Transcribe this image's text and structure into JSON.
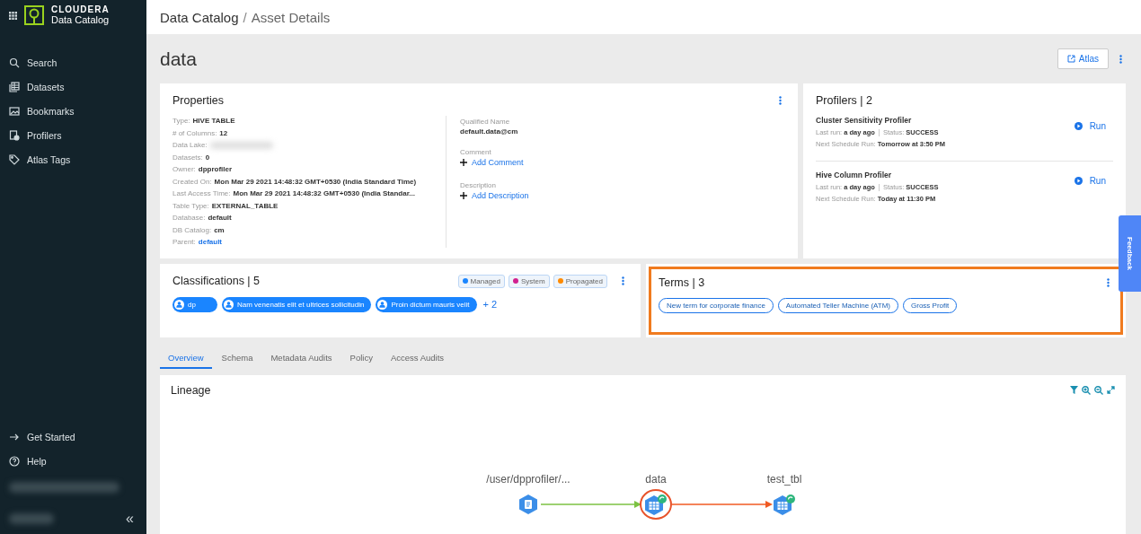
{
  "sidebar": {
    "brand": {
      "name": "CLOUDERA",
      "product": "Data Catalog"
    },
    "items": [
      {
        "label": "Search",
        "selected": false
      },
      {
        "label": "Datasets",
        "selected": false
      },
      {
        "label": "Bookmarks",
        "selected": false
      },
      {
        "label": "Profilers",
        "selected": false
      },
      {
        "label": "Atlas Tags",
        "selected": false
      }
    ],
    "footer_items": [
      {
        "label": "Get Started"
      },
      {
        "label": "Help"
      }
    ],
    "collapse": "«"
  },
  "header": {
    "breadcrumb": [
      "Data Catalog",
      "Asset Details"
    ],
    "separator": "/"
  },
  "asset": {
    "title": "data",
    "atlas_button": "Atlas"
  },
  "properties": {
    "title": "Properties",
    "fields": [
      {
        "label": "Type:",
        "value": "HIVE TABLE",
        "kind": "text"
      },
      {
        "label": "# of Columns:",
        "value": "12",
        "kind": "text"
      },
      {
        "label": "Data Lake:",
        "kind": "redacted"
      },
      {
        "label": "Datasets:",
        "value": "0",
        "kind": "text"
      },
      {
        "label": "Owner:",
        "value": "dpprofiler",
        "kind": "text"
      },
      {
        "label": "Created On:",
        "value": "Mon Mar 29 2021 14:48:32 GMT+0530 (India Standard Time)",
        "kind": "text"
      },
      {
        "label": "Last Access Time:",
        "value": "Mon Mar 29 2021 14:48:32 GMT+0530 (India Standar...",
        "kind": "text"
      },
      {
        "label": "Table Type:",
        "value": "EXTERNAL_TABLE",
        "kind": "text"
      },
      {
        "label": "Database:",
        "value": "default",
        "kind": "text"
      },
      {
        "label": "DB Catalog:",
        "value": "cm",
        "kind": "text"
      },
      {
        "label": "Parent:",
        "value": "default",
        "kind": "link"
      }
    ],
    "qualified_name": {
      "label": "Qualified Name",
      "value": "default.data@cm"
    },
    "comment": {
      "label": "Comment",
      "action": "Add Comment"
    },
    "description": {
      "label": "Description",
      "action": "Add Description"
    }
  },
  "profilers": {
    "title": "Profilers | 2",
    "items": [
      {
        "name": "Cluster Sensitivity Profiler",
        "last_run_label": "Last run:",
        "last_run": "a day ago",
        "status_label": "Status:",
        "status": "SUCCESS",
        "next_label": "Next Schedule Run:",
        "next": "Tomorrow at 3:50 PM",
        "action": "Run"
      },
      {
        "name": "Hive Column Profiler",
        "last_run_label": "Last run:",
        "last_run": "a day ago",
        "status_label": "Status:",
        "status": "SUCCESS",
        "next_label": "Next Schedule Run:",
        "next": "Today at 11:30 PM",
        "action": "Run"
      }
    ]
  },
  "classifications": {
    "title": "Classifications | 5",
    "legend": [
      {
        "label": "Managed",
        "color": "#1a85ff"
      },
      {
        "label": "System",
        "color": "#d1208f"
      },
      {
        "label": "Propagated",
        "color": "#ff8a00"
      }
    ],
    "tags": [
      "dp",
      "Nam venenatis elit et ultrices sollicitudin",
      "Proin dictum mauris velit"
    ],
    "more": "+ 2"
  },
  "terms": {
    "title": "Terms | 3",
    "highlighted": true,
    "items": [
      "New term for corporate finance",
      "Automated Teller Machine (ATM)",
      "Gross Profit"
    ]
  },
  "tabs": [
    {
      "label": "Overview",
      "selected": true
    },
    {
      "label": "Schema",
      "selected": false
    },
    {
      "label": "Metadata Audits",
      "selected": false
    },
    {
      "label": "Policy",
      "selected": false
    },
    {
      "label": "Access Audits",
      "selected": false
    }
  ],
  "lineage": {
    "title": "Lineage",
    "nodes": [
      {
        "label": "/user/dpprofiler/...",
        "kind": "hdfs",
        "selected": false
      },
      {
        "label": "data",
        "kind": "table",
        "selected": true
      },
      {
        "label": "test_tbl",
        "kind": "table",
        "selected": false
      }
    ]
  },
  "feedback": "Feedback"
}
